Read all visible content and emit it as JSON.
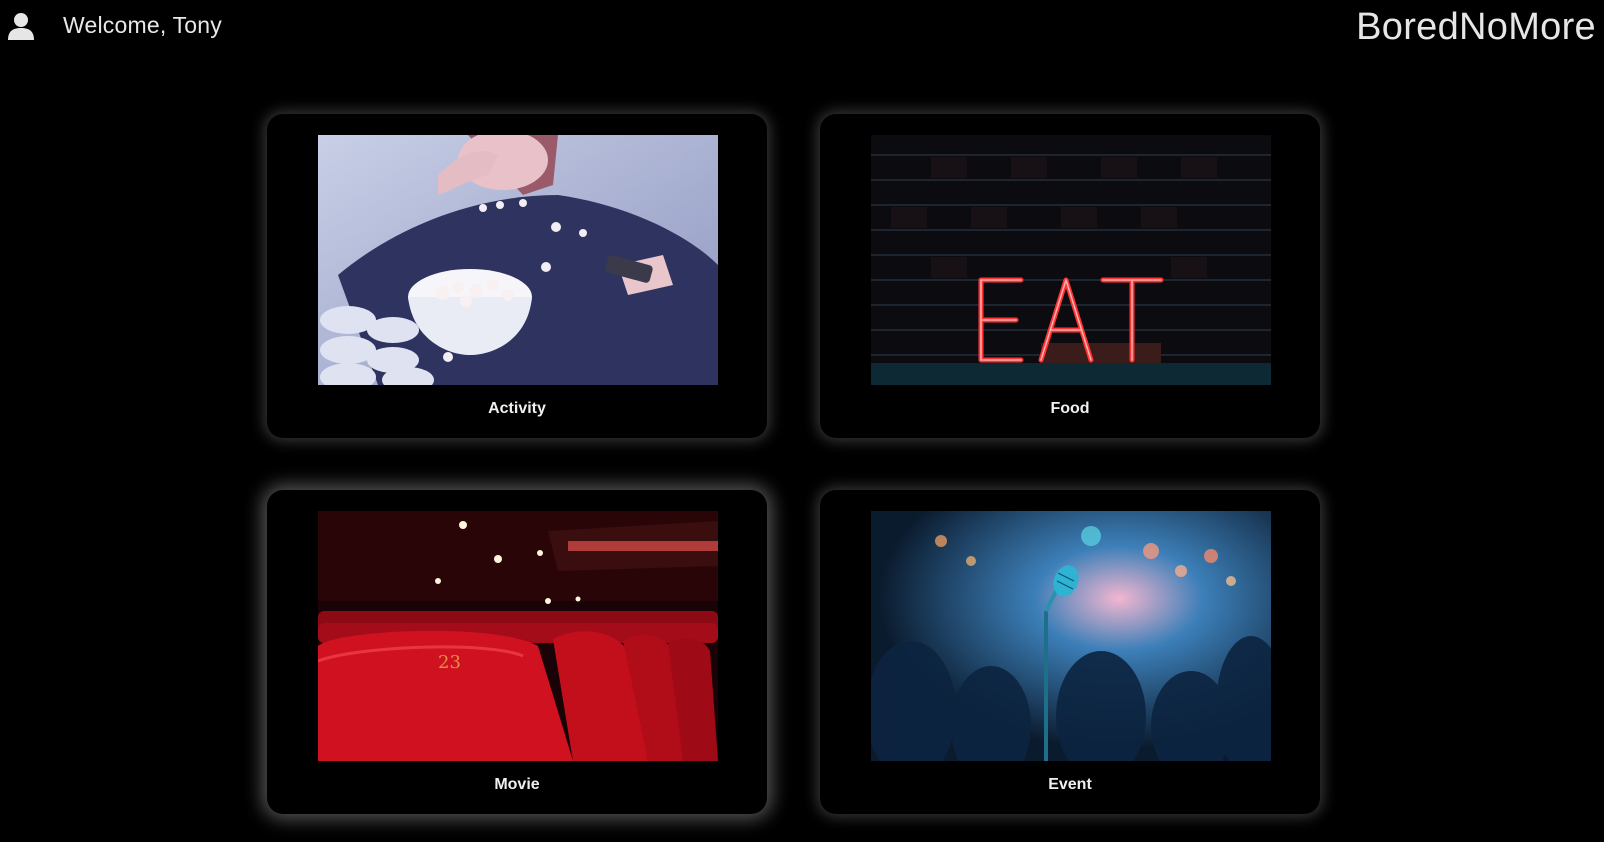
{
  "header": {
    "welcome_text": "Welcome, Tony",
    "brand": "BoredNoMore",
    "user_icon": "user-icon"
  },
  "cards": [
    {
      "label": "Activity",
      "image": "woman-eating-popcorn-photo"
    },
    {
      "label": "Food",
      "image": "eat-neon-sign-photo",
      "sign_text": "EAT"
    },
    {
      "label": "Movie",
      "image": "red-cinema-seats-photo",
      "seat_number": "23"
    },
    {
      "label": "Event",
      "image": "microphone-stage-lights-photo"
    }
  ],
  "colors": {
    "background": "#000000",
    "text": "#e8e8e8",
    "neon_red": "#ff2a2a",
    "seat_red": "#c8101c"
  }
}
